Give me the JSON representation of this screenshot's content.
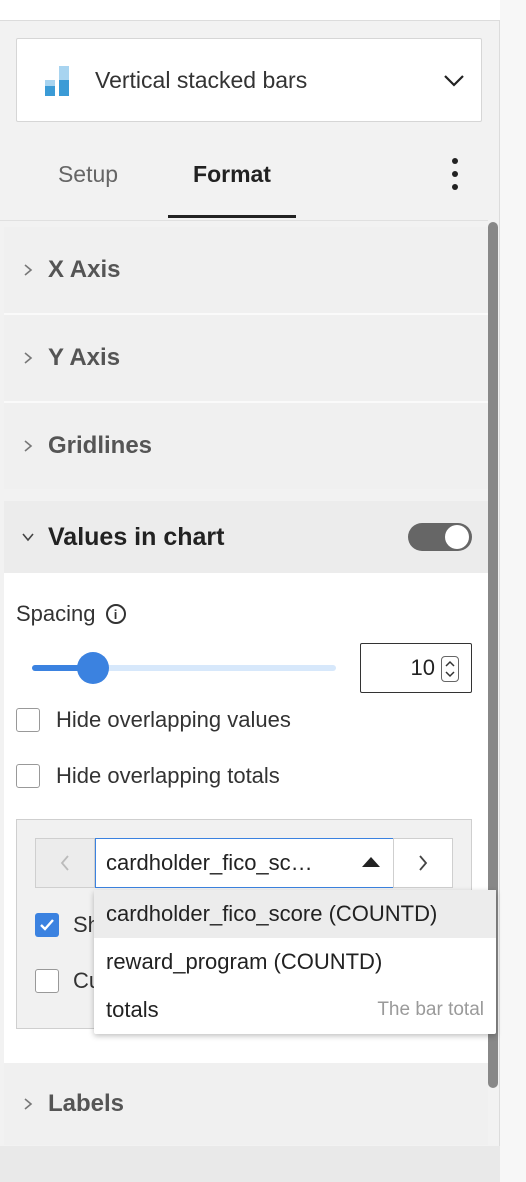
{
  "chart_type": {
    "label": "Vertical stacked bars",
    "icon": "stacked-bars-icon"
  },
  "tabs": {
    "setup": "Setup",
    "format": "Format"
  },
  "sections": {
    "x_axis": "X Axis",
    "y_axis": "Y Axis",
    "gridlines": "Gridlines",
    "values_in_chart": "Values in chart",
    "labels": "Labels"
  },
  "values": {
    "toggle_on": true,
    "spacing_label": "Spacing",
    "spacing_value": "10",
    "slider_level": 0.2,
    "hide_overlapping_values": "Hide overlapping values",
    "hide_overlapping_totals": "Hide overlapping totals",
    "selected_measure": "cardholder_fico_sc…",
    "show_checkbox_label": "Sh",
    "custom_checkbox_label": "Cu"
  },
  "dropdown": {
    "items": [
      {
        "label": "cardholder_fico_score (COUNTD)",
        "hint": ""
      },
      {
        "label": "reward_program (COUNTD)",
        "hint": ""
      },
      {
        "label": "totals",
        "hint": "The bar total"
      }
    ]
  },
  "colors": {
    "accent": "#3b82e0",
    "chart_light": "#a8d4f0",
    "chart_dark": "#3b9bd6"
  }
}
